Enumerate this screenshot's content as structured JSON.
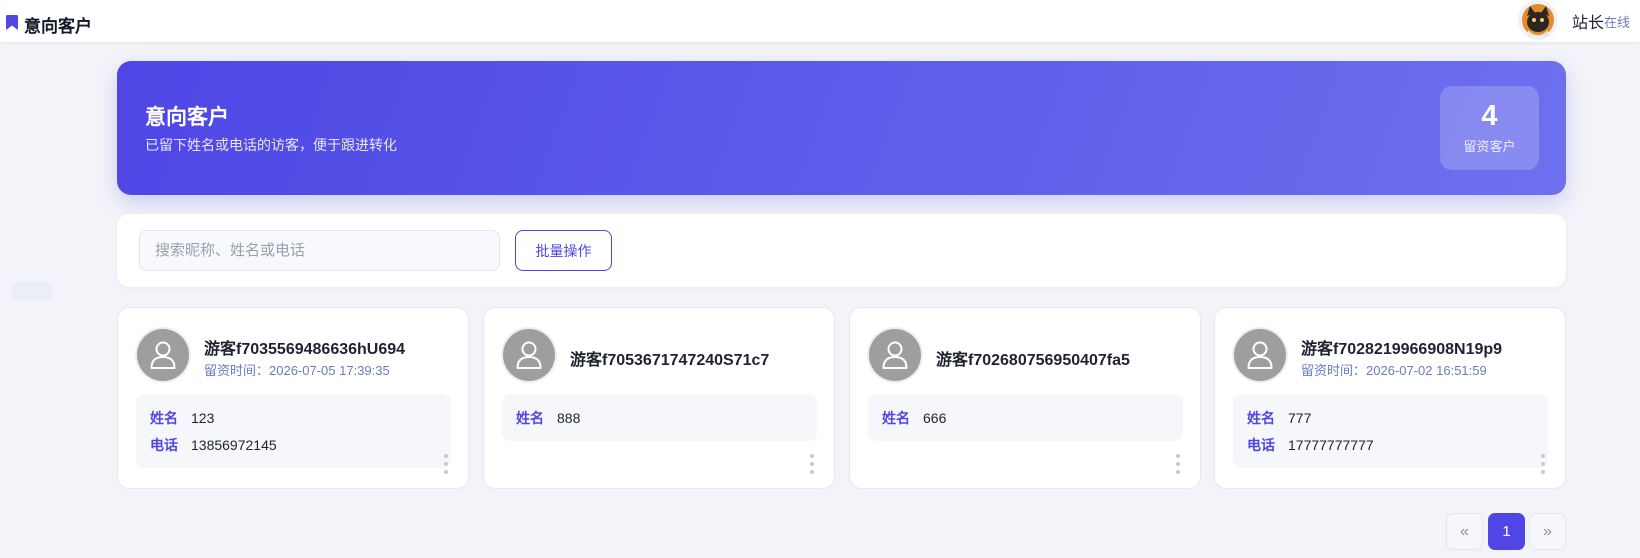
{
  "topbar": {
    "title": "意向客户",
    "user_name": "站长",
    "user_status": "在线"
  },
  "hero": {
    "title": "意向客户",
    "subtitle": "已留下姓名或电话的访客，便于跟进转化",
    "stat_value": "4",
    "stat_label": "留资客户"
  },
  "toolbar": {
    "search_placeholder": "搜索昵称、姓名或电话",
    "batch_label": "批量操作"
  },
  "cards": [
    {
      "name": "游客f7035569486636hU694",
      "time_label": "留资时间：",
      "time_value": "2026-07-05 17:39:35",
      "fields": [
        {
          "key": "姓名",
          "value": "123"
        },
        {
          "key": "电话",
          "value": "13856972145"
        }
      ]
    },
    {
      "name": "游客f7053671747240S71c7",
      "fields": [
        {
          "key": "姓名",
          "value": "888"
        }
      ]
    },
    {
      "name": "游客f702680756950407fa5",
      "fields": [
        {
          "key": "姓名",
          "value": "666"
        }
      ]
    },
    {
      "name": "游客f7028219966908N19p9",
      "time_label": "留资时间：",
      "time_value": "2026-07-02 16:51:59",
      "fields": [
        {
          "key": "姓名",
          "value": "777"
        },
        {
          "key": "电话",
          "value": "17777777777"
        }
      ]
    }
  ],
  "pagination": {
    "prev": "«",
    "current": "1",
    "next": "»"
  },
  "colors": {
    "accent": "#4f46e5",
    "link": "#6b7bbf",
    "background": "#f3f4f9"
  },
  "icons": {
    "topbar": "bookmark-icon",
    "card_avatar": "user-icon",
    "card_menu": "more-vertical-icon"
  }
}
